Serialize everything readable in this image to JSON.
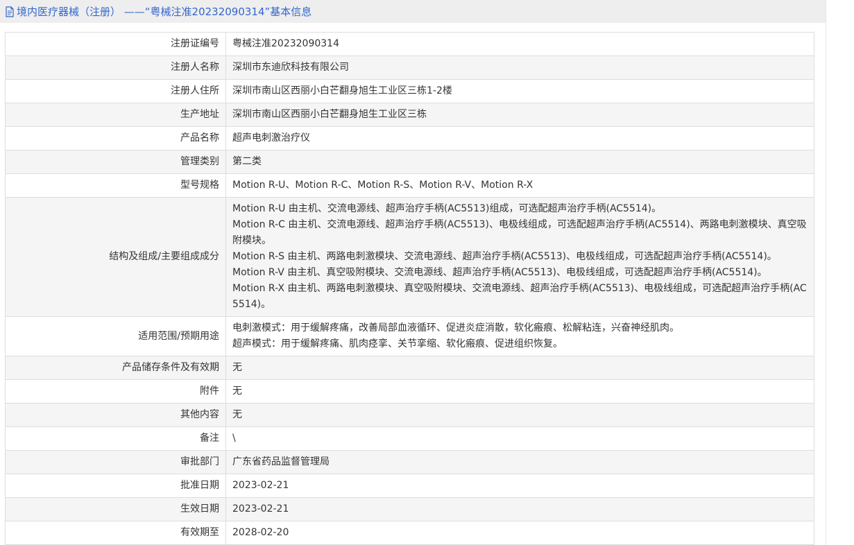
{
  "header": {
    "title": "境内医疗器械（注册） ——“粤械注准20232090314”基本信息",
    "icon": "document-icon"
  },
  "rows": [
    {
      "label": "注册证编号",
      "value": "粤械注准20232090314"
    },
    {
      "label": "注册人名称",
      "value": "深圳市东迪欣科技有限公司"
    },
    {
      "label": "注册人住所",
      "value": "深圳市南山区西丽小白芒翻身旭生工业区三栋1-2楼"
    },
    {
      "label": "生产地址",
      "value": "深圳市南山区西丽小白芒翻身旭生工业区三栋"
    },
    {
      "label": "产品名称",
      "value": "超声电刺激治疗仪"
    },
    {
      "label": "管理类别",
      "value": "第二类"
    },
    {
      "label": "型号规格",
      "value": "Motion R-U、Motion R-C、Motion R-S、Motion R-V、Motion R-X"
    },
    {
      "label": "结构及组成/主要组成成分",
      "lines": [
        "Motion R-U 由主机、交流电源线、超声治疗手柄(AC5513)组成，可选配超声治疗手柄(AC5514)。",
        "Motion R-C 由主机、交流电源线、超声治疗手柄(AC5513)、电极线组成，可选配超声治疗手柄(AC5514)、两路电刺激模块、真空吸附模块。",
        "Motion R-S 由主机、两路电刺激模块、交流电源线、超声治疗手柄(AC5513)、电极线组成，可选配超声治疗手柄(AC5514)。",
        "Motion R-V 由主机、真空吸附模块、交流电源线、超声治疗手柄(AC5513)、电极线组成，可选配超声治疗手柄(AC5514)。",
        "Motion R-X 由主机、两路电刺激模块、真空吸附模块、交流电源线、超声治疗手柄(AC5513)、电极线组成，可选配超声治疗手柄(AC5514)。"
      ]
    },
    {
      "label": "适用范围/预期用途",
      "lines": [
        "电刺激模式：用于缓解疼痛，改善局部血液循环、促进炎症消散，软化瘢痕、松解粘连，兴奋神经肌肉。",
        "超声模式：用于缓解疼痛、肌肉痉挛、关节挛缩、软化瘢痕、促进组织恢复。"
      ]
    },
    {
      "label": "产品储存条件及有效期",
      "value": "无"
    },
    {
      "label": "附件",
      "value": "无"
    },
    {
      "label": "其他内容",
      "value": "无"
    },
    {
      "label": "备注",
      "value": "\\"
    },
    {
      "label": "审批部门",
      "value": "广东省药品监督管理局"
    },
    {
      "label": "批准日期",
      "value": "2023-02-21"
    },
    {
      "label": "生效日期",
      "value": "2023-02-21"
    },
    {
      "label": "有效期至",
      "value": "2028-02-20"
    }
  ],
  "colors": {
    "title_text": "#3366cc",
    "title_bar_bg": "#eeeeee",
    "row_alt_bg": "#f5f5f5",
    "border": "#dddddd"
  }
}
